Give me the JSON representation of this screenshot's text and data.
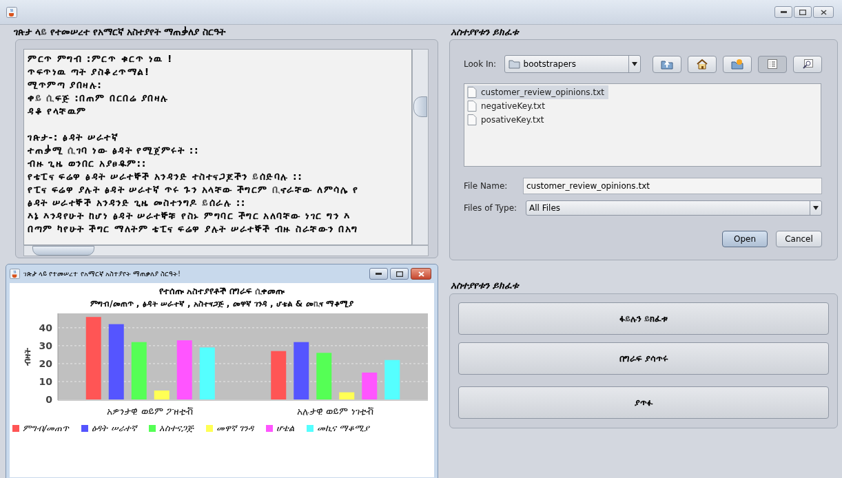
{
  "main_panel": {
    "title": "ገጽታ ላይ የተመሠረተ የአማርኛ አስተያየት ማጠቃለያ ስርዓት",
    "paragraphs": [
      [
        "ምርጥ ምግብ :ምርጥ ቁርጥ ነዉ !",
        "ጥፍጥነዉ ጣት ያስቆረጥማል!",
        "ሚጥምጣ ያበዛሉ:",
        "ቀይ ሲፍጅ :በጠም በርበሬ  ያበዛሉ",
        "ዳቆ የላቸዉም"
      ],
      [
        "ገጽታ-: ፅዳት ሠራተኛ",
        "ተጠቃሚ ሲገባ ነው ፅዳት የሚጀምሩት ::",
        "ብዙ ጊዜ ወንበር አያፀዱም::",
        "የቴፒና ፍሬዋ ፅዳት ሠራተኞች አንዳንድ ተስተናጋጆችን ይሰድባሉ ::",
        "የፒና ፍሬዋ ያሉት ፅዳት ሠራተኛ ጥሩ ጉን አላቸው ችግርም ቢኖራቸው ለምሳሌ የ",
        "ፅዳት ሠራተኞች አንዳንድ ጊዜ መስተንግዶ ይሰራሉ ::",
        "እኔ እንዳየሁት ከሆነ ፅዳት ሠራተኞቹ የስኑ ምግባር ችግር አለባቸው  ነገር ግን እ",
        "በጣም ካየሁት ችግር ማለትም ቴፒና ፍሬዋ ያሉት ሠራተኞች ብዙ ስራቸውን በአግ"
      ]
    ]
  },
  "chart_window": {
    "title": "ገጽታ ላይ የተመሠረተ የአማርኛ አስተያየት ማጠቃለያ ስርዓት!",
    "subtitle": "ምግብ/መጠጥ  , ፅዳት ሠራተኛ , አስተናጋጅ , መዋኛ ገንዳ , ሆቴል & መኪና ማቆሚያ",
    "chart_data": {
      "type": "bar",
      "title": "የተሰጡ አስተያየቶች በግራፍ ሲቀመጡ",
      "ylabel": "ብዛት",
      "categories": [
        "አዎንታዊ ወይም ፖዘቲቭ",
        "አሉታዊ ወይም ነገቲቭ"
      ],
      "ylim": [
        0,
        48
      ],
      "grid": true,
      "yticks": [
        0,
        10,
        20,
        30,
        40
      ],
      "series": [
        {
          "name": "ምግብ/መጠጥ",
          "color": "#ff5555",
          "values": [
            46,
            27
          ]
        },
        {
          "name": "ፅዳት ሠራተኛ",
          "color": "#5555ff",
          "values": [
            42,
            32
          ]
        },
        {
          "name": "አስተናጋጅ",
          "color": "#55ff55",
          "values": [
            32,
            26
          ]
        },
        {
          "name": "መዋኛ ገንዳ",
          "color": "#ffff55",
          "values": [
            5,
            4
          ]
        },
        {
          "name": "ሆቴል",
          "color": "#ff55ff",
          "values": [
            33,
            15
          ]
        },
        {
          "name": "መኪና ማቆሚያ",
          "color": "#55ffff",
          "values": [
            29,
            22
          ]
        }
      ]
    }
  },
  "file_chooser": {
    "title": "አስተያየቱን ይክፈቱ",
    "look_in": {
      "label": "Look In:",
      "value": "bootstrapers"
    },
    "files": [
      {
        "name": "customer_review_opinions.txt",
        "selected": true
      },
      {
        "name": "negativeKey.txt",
        "selected": false
      },
      {
        "name": "posativeKey.txt",
        "selected": false
      }
    ],
    "file_name": {
      "label": "File Name:",
      "value": "customer_review_opinions.txt"
    },
    "files_of_type": {
      "label": "Files of Type:",
      "value": "All Files"
    },
    "buttons": [
      "Open",
      "Cancel"
    ]
  },
  "actions": {
    "title": "አስተያየቱን ይክፈቱ",
    "buttons": [
      "ፋይሉን ይክፈቱ",
      "በግራፍ ያሳጥሩ",
      "ያጥፉ"
    ]
  }
}
